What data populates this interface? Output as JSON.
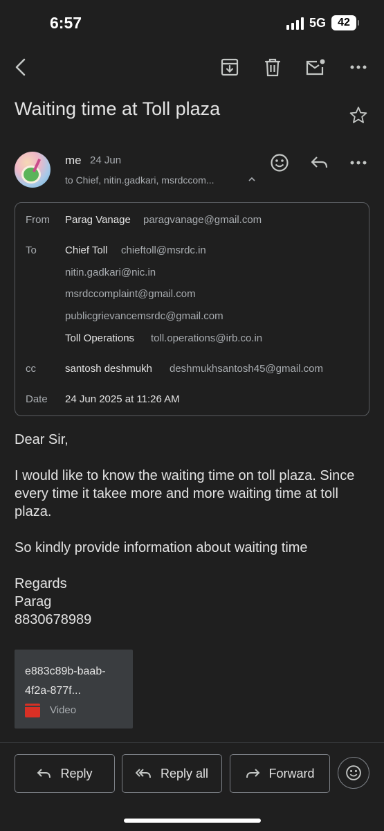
{
  "status": {
    "time": "6:57",
    "network": "5G",
    "battery": "42"
  },
  "toolbar": {
    "back_icon": "back-arrow-icon",
    "archive_icon": "archive-icon",
    "delete_icon": "trash-icon",
    "mark_unread_icon": "mail-unread-icon",
    "more_icon": "more-vert-icon"
  },
  "email": {
    "subject": "Waiting time at Toll plaza",
    "sender": {
      "name": "me",
      "date": "24 Jun",
      "to_summary": "to Chief, nitin.gadkari, msrdccom..."
    },
    "details": {
      "from_label": "From",
      "from_name": "Parag Vanage",
      "from_email": "paragvanage@gmail.com",
      "to_label": "To",
      "to": [
        {
          "name": "Chief Toll",
          "email": "chieftoll@msrdc.in"
        },
        {
          "name": "",
          "email": "nitin.gadkari@nic.in"
        },
        {
          "name": "",
          "email": "msrdccomplaint@gmail.com"
        },
        {
          "name": "",
          "email": "publicgrievancemsrdc@gmail.com"
        },
        {
          "name": "Toll Operations",
          "email": "toll.operations@irb.co.in"
        }
      ],
      "cc_label": "cc",
      "cc_name": "santosh deshmukh",
      "cc_email": "deshmukhsantosh45@gmail.com",
      "date_label": "Date",
      "date_value": "24 Jun 2025 at 11:26 AM"
    },
    "body": {
      "greeting": "Dear Sir,",
      "para1": "I would like to know the waiting time on toll plaza. Since every time it takee more and more waiting time at toll plaza.",
      "para2": "So kindly provide information about waiting time",
      "sign1": "Regards",
      "sign2": "Parag",
      "sign3": "8830678989"
    },
    "attachment": {
      "name": "e883c89b-baab-4f2a-877f...",
      "type": "Video"
    }
  },
  "actions": {
    "reply": "Reply",
    "reply_all": "Reply all",
    "forward": "Forward"
  },
  "colors": {
    "background": "#1f1f1f",
    "text": "#e3e3e3",
    "muted": "#a8acb0",
    "video_icon": "#d93025"
  }
}
